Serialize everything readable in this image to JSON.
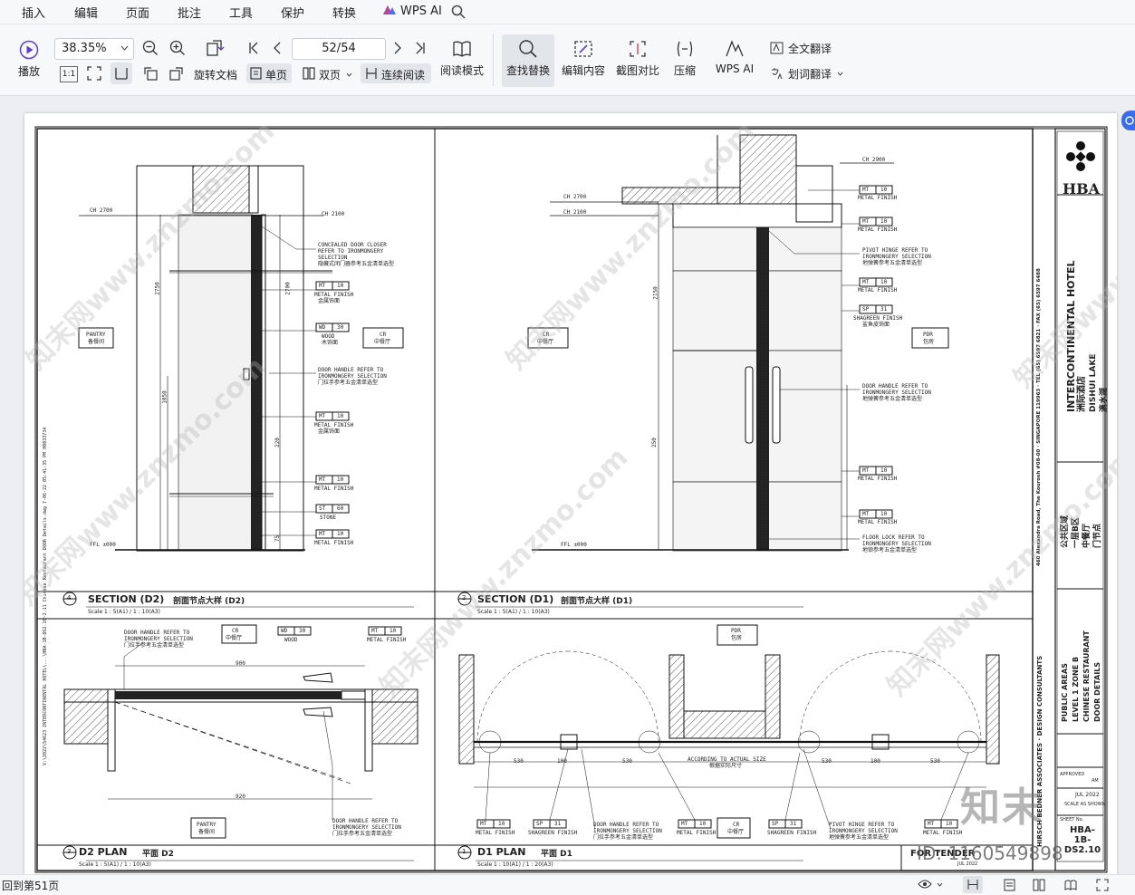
{
  "menu": {
    "items": [
      "插入",
      "编辑",
      "页面",
      "批注",
      "工具",
      "保护",
      "转换"
    ],
    "ai_label": "WPS AI"
  },
  "toolbar": {
    "play_label": "播放",
    "zoom_value": "38.35%",
    "page_value": "52/54",
    "rotate_label": "旋转文档",
    "single_label": "单页",
    "double_label": "双页",
    "continuous_label": "连续阅读",
    "reading_label": "阅读模式",
    "find_label": "查找替换",
    "edit_label": "编辑内容",
    "compare_label": "截图对比",
    "compress_label": "压缩",
    "wpsai_label": "WPS AI",
    "fulltrans_label": "全文翻译",
    "wordtrans_label": "划词翻译",
    "fit_label": "1:1"
  },
  "drawing": {
    "section_d2": {
      "no": "4",
      "title": "SECTION (D2)",
      "cn": "剖面节点大样 (D2)",
      "scale": "Scale 1 : 5(A1) / 1 : 10(A3)"
    },
    "section_d1": {
      "no": "2",
      "title": "SECTION (D1)",
      "cn": "剖面节点大样 (D1)",
      "scale": "Scale 1 : 5(A1) / 1 : 10(A3)"
    },
    "plan_d2": {
      "no": "3",
      "title": "D2 PLAN",
      "cn": "平面 D2",
      "scale": "Scale 1 : 5(A1) / 1 : 10(A3)"
    },
    "plan_d1": {
      "no": "1",
      "title": "D1 PLAN",
      "cn": "平面 D1",
      "scale": "Scale 1 : 10(A1) / 1 : 20(A3)"
    },
    "rooms": {
      "pantry": "PANTRY",
      "pantry_cn": "备餐间",
      "cr": "CR",
      "cr_cn": "中餐厅",
      "pdr": "PDR",
      "pdr_cn": "包房"
    },
    "levels": {
      "ch2700": "CH 2700",
      "ch2100": "CH 2100",
      "ch2900": "CH 2900",
      "ffl": "FFL ±000"
    },
    "notes": {
      "closer": "CONCEALED DOOR CLOSER",
      "closer2": "REFER TO IRONMONGERY",
      "closer3": "SELECTION",
      "closer_cn": "隐藏式闭门器参考五金清单选型",
      "handle": "DOOR HANDLE REFER TO",
      "handle2": "IRONMONGERY SELECTION",
      "handle_cn": "门拉手参考五金清单选型",
      "hinge": "PIVOT HINGE REFER TO",
      "hinge2": "IRONMONGERY SELECTION",
      "hinge_cn": "地弹簧参考五金清单选型",
      "lock": "FLOOR LOCK REFER TO",
      "lock2": "IRONMONGERY SELECTION",
      "lock_cn": "地锁参考五金清单选型",
      "metal": "METAL FINISH",
      "metal_cn": "金属饰面",
      "wood": "WOOD",
      "wood_cn": "木饰面",
      "stone": "STONE",
      "stone_cn": "石材",
      "shagreen": "SHAGREEN FINISH",
      "shagreen_cn": "鲨鱼皮饰面",
      "actual": "ACCORDING TO ACTUAL SIZE",
      "actual_cn": "根据实际尺寸"
    },
    "tags": {
      "mt": "MT",
      "mt_no": "10",
      "wd": "WD",
      "wd_no": "30",
      "st": "ST",
      "st_no": "60",
      "sp": "SP",
      "sp_no": "31"
    },
    "dims": {
      "d2750": "2750",
      "d2700": "2700",
      "d1050": "1050",
      "d220": "220",
      "d75": "75",
      "d900": "900",
      "d920": "920",
      "d530": "530",
      "d100": "100",
      "d2150": "2150",
      "d250": "250"
    },
    "titleblock": {
      "brand": "HBA",
      "hotel": "INTERCONTINENTAL HOTEL",
      "hotel_cn": "洲际酒店",
      "loc": "DISHUI LAKE",
      "loc_cn": "滴水湖",
      "area_cn": "公共区域",
      "level_cn": "一层B区",
      "rest_cn": "中餐厅",
      "det_cn": "门节点",
      "area": "PUBLIC AREAS",
      "level": "LEVEL 1 ZONE B",
      "rest": "CHINESE RESTAURANT",
      "det": "DOOR DETAILS",
      "consult": "HIRSCH BEDNER ASSOCIATES · DESIGN CONSULTANTS",
      "address": "460 Alexandra Road, The Kourosh #08-00 · SINGAPORE 119963 · TEL (65) 6597 6821 · FAX (65) 6597 6488",
      "approved": "APPROVED",
      "checked_by": "AM",
      "date": "JUL 2022",
      "scale_lbl": "SCALE AS SHOWN",
      "sheet": "HBA-1B-DS2.10",
      "tender": "FOR TENDER",
      "sheet_no_lbl": "SHEET No."
    },
    "sidefile": "V:\\2022\\54623 INTERCONTINENTAL HOTEL\\...\\HBA-1B-DS2.10~2.11 Chinese Restaurant DOOR Details.dwg  7-06-22  05:41:35 PM  H0033734",
    "watermark": "知末网www.znzmo.com"
  },
  "overlay": {
    "zhihu": "知末",
    "id": "ID: 1160549898"
  },
  "status": {
    "page_text": "回到第51页"
  }
}
